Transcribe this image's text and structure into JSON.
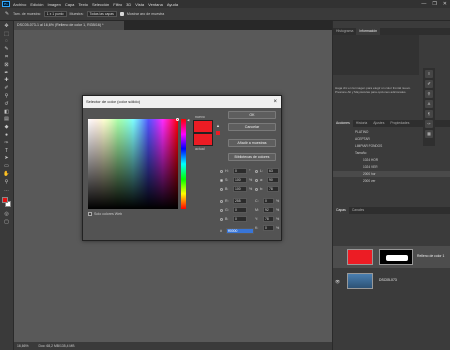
{
  "menubar": {
    "items": [
      "Archivo",
      "Edición",
      "Imagen",
      "Capa",
      "Texto",
      "Selección",
      "Filtro",
      "3D",
      "Vista",
      "Ventana",
      "Ayuda"
    ],
    "window_controls": [
      "—",
      "❐",
      "✕"
    ]
  },
  "options_bar": {
    "sample_size_label": "Tam. de muestra:",
    "sample_size_value": "1 x 1 punto",
    "sample_label": "Muestra:",
    "sample_value": "Todas las capas",
    "show_ring_label": "Mostrar aro de muestra"
  },
  "document": {
    "tab_title": "DSC05-073-1 al 16,6% (Relleno de color 1, RGB/16) *",
    "status_zoom": "16,66%",
    "status_info": "Doc: 68,2 MB/135,4 MB"
  },
  "right_panel": {
    "top_tabs": [
      "Histograma",
      "Información"
    ],
    "actions_tabs": [
      "Acciones",
      "Historia",
      "Ajustes",
      "Propiedades"
    ],
    "actions": [
      "PLATINO",
      "ACEPTAR",
      "LIMPIAR FONDOS",
      "Tamaño",
      "1024 HOR",
      "1024 VER",
      "2000 hor",
      "2000 ver"
    ],
    "layers_tabs": [
      "Capas",
      "Canales"
    ],
    "layers": [
      "Relleno de color 1",
      "DSC05-073"
    ],
    "info_text": "Haga clic en la imagen para elegir un color frontal nuevo. Presione Alt y Mayúsculas para opciones adicionales."
  },
  "color_dialog": {
    "title": "Selector de color (color sólido)",
    "new_label": "nuevo",
    "current_label": "actual",
    "ok_label": "OK",
    "cancel_label": "Cancelar",
    "add_swatch_label": "Añadir a muestras",
    "libraries_label": "Bibliotecas de colores",
    "web_only_label": "Solo colores Web",
    "h_label": "H:",
    "h_value": "0",
    "h_unit": "°",
    "s_label": "S:",
    "s_value": "100",
    "s_unit": "%",
    "b_label": "B:",
    "b_value": "100",
    "b_unit": "%",
    "r_label": "R:",
    "r_value": "255",
    "g_label": "G:",
    "g_value": "0",
    "b2_label": "B:",
    "b2_value": "0",
    "l_label": "L:",
    "l_value": "63",
    "a_label": "a:",
    "a_value": "90",
    "bb_label": "b:",
    "bb_value": "78",
    "c_label": "C:",
    "c_value": "0",
    "c_unit": "%",
    "m_label": "M:",
    "m_value": "92",
    "m_unit": "%",
    "y_label": "Y:",
    "y_value": "78",
    "y_unit": "%",
    "k_label": "K:",
    "k_value": "0",
    "k_unit": "%",
    "hex_label": "#",
    "hex_value": "ff0000",
    "new_color": "#ec1c24",
    "current_color": "#ec1c24"
  },
  "colors": {
    "foreground": "#e01010",
    "background": "#ffffff"
  }
}
